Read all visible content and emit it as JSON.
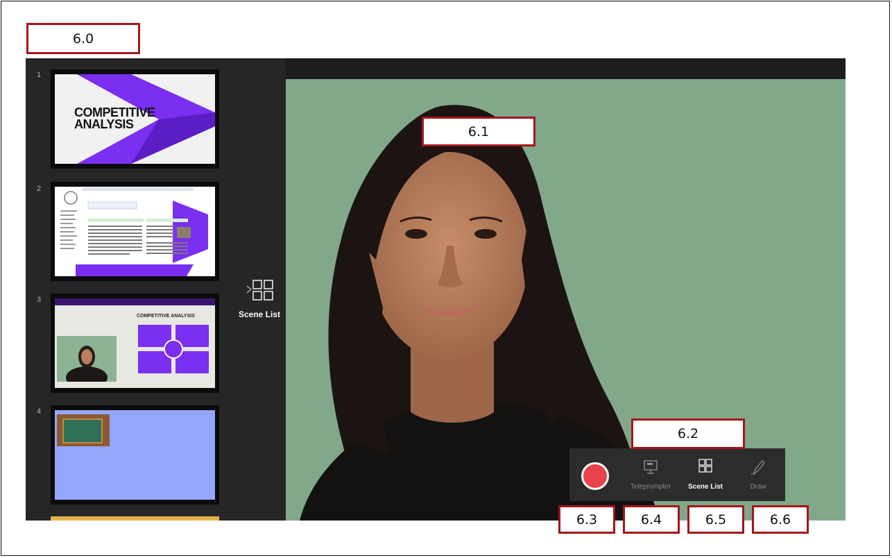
{
  "callouts": {
    "c60": "6.0",
    "c61": "6.1",
    "c62": "6.2",
    "c63": "6.3",
    "c64": "6.4",
    "c65": "6.5",
    "c66": "6.6"
  },
  "slides": [
    {
      "number": "1",
      "title_line1": "COMPETITIVE",
      "title_line2": "ANALYSIS"
    },
    {
      "number": "2"
    },
    {
      "number": "3",
      "heading": "COMPETITIVE ANALYSIS"
    },
    {
      "number": "4"
    }
  ],
  "scene_list_tab": {
    "label": "Scene List",
    "icon": "grid-icon"
  },
  "toolbar": {
    "record": {
      "icon": "record-icon"
    },
    "teleprompter": {
      "label": "Teleprompter",
      "icon": "monitor-icon"
    },
    "scene_list": {
      "label": "Scene List",
      "icon": "grid-icon"
    },
    "draw": {
      "label": "Draw",
      "icon": "pen-icon"
    }
  },
  "colors": {
    "accent_purple": "#7b2ff0",
    "record_red": "#e8434a",
    "stage_green": "#82a88a",
    "callout_border": "#a3151b"
  }
}
